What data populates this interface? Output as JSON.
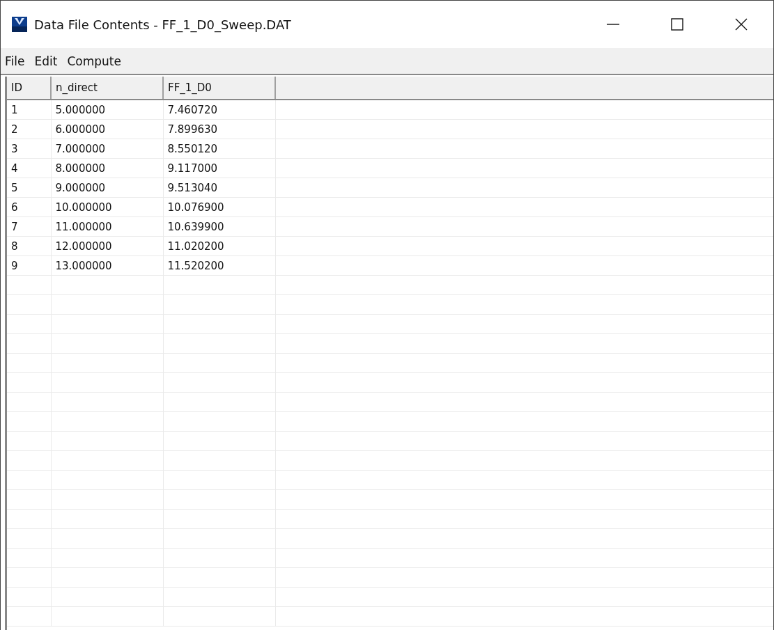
{
  "window": {
    "title": "Data File Contents - FF_1_D0_Sweep.DAT"
  },
  "menu": [
    "File",
    "Edit",
    "Compute"
  ],
  "table": {
    "columns": [
      "ID",
      "n_direct",
      "FF_1_D0"
    ],
    "rows": [
      [
        "1",
        "5.000000",
        "7.460720"
      ],
      [
        "2",
        "6.000000",
        "7.899630"
      ],
      [
        "3",
        "7.000000",
        "8.550120"
      ],
      [
        "4",
        "8.000000",
        "9.117000"
      ],
      [
        "5",
        "9.000000",
        "9.513040"
      ],
      [
        "6",
        "10.000000",
        "10.076900"
      ],
      [
        "7",
        "11.000000",
        "10.639900"
      ],
      [
        "8",
        "12.000000",
        "11.020200"
      ],
      [
        "9",
        "13.000000",
        "11.520200"
      ]
    ]
  }
}
